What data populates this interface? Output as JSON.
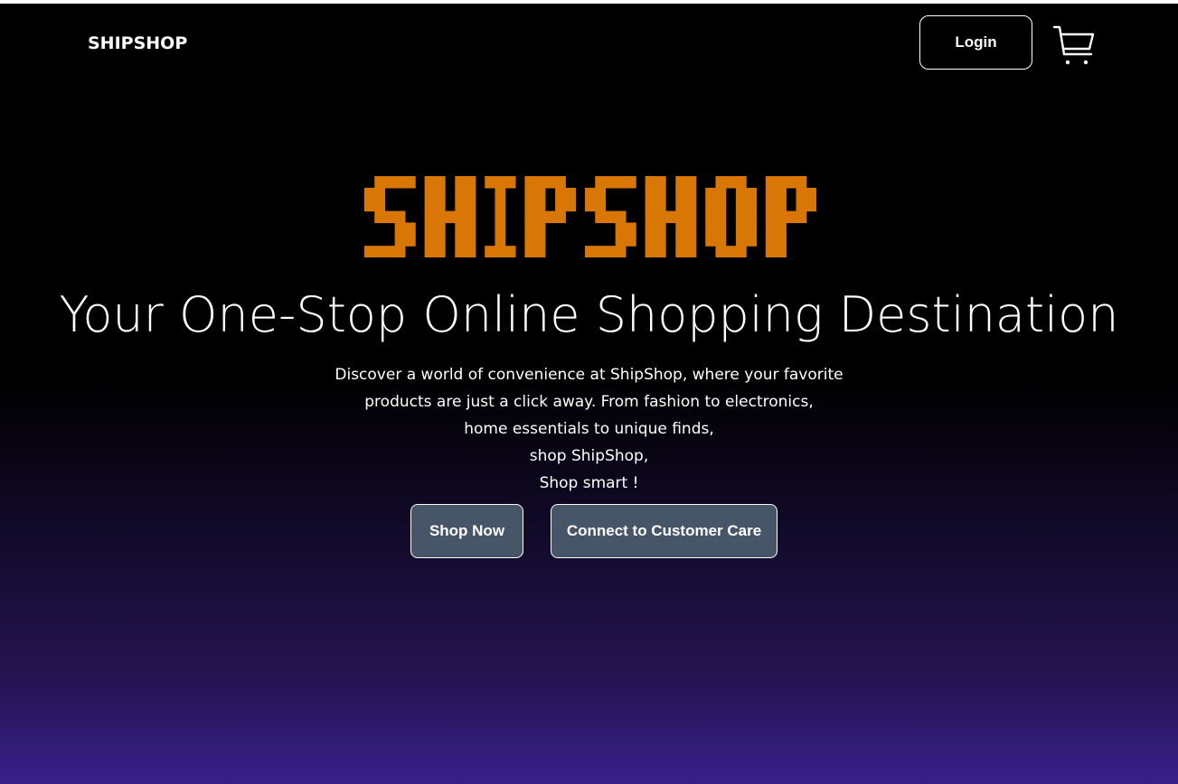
{
  "header": {
    "brand": "SHIPSHOP",
    "login_label": "Login",
    "cart_icon": "shopping-cart-icon"
  },
  "hero": {
    "logo_text": "SHIPSHOP",
    "logo_color": "#d97706",
    "headline": "Your One-Stop Online Shopping Destination",
    "description_lines": [
      "Discover a world of convenience at ShipShop, where your favorite",
      "products are just a click away. From fashion to electronics,",
      "home essentials to unique finds,",
      "shop ShipShop,",
      "Shop smart !"
    ],
    "shop_now_label": "Shop Now",
    "customer_care_label": "Connect to Customer Care"
  },
  "colors": {
    "background_top": "#000000",
    "background_bottom": "#37208a",
    "button_bg": "#475569"
  }
}
